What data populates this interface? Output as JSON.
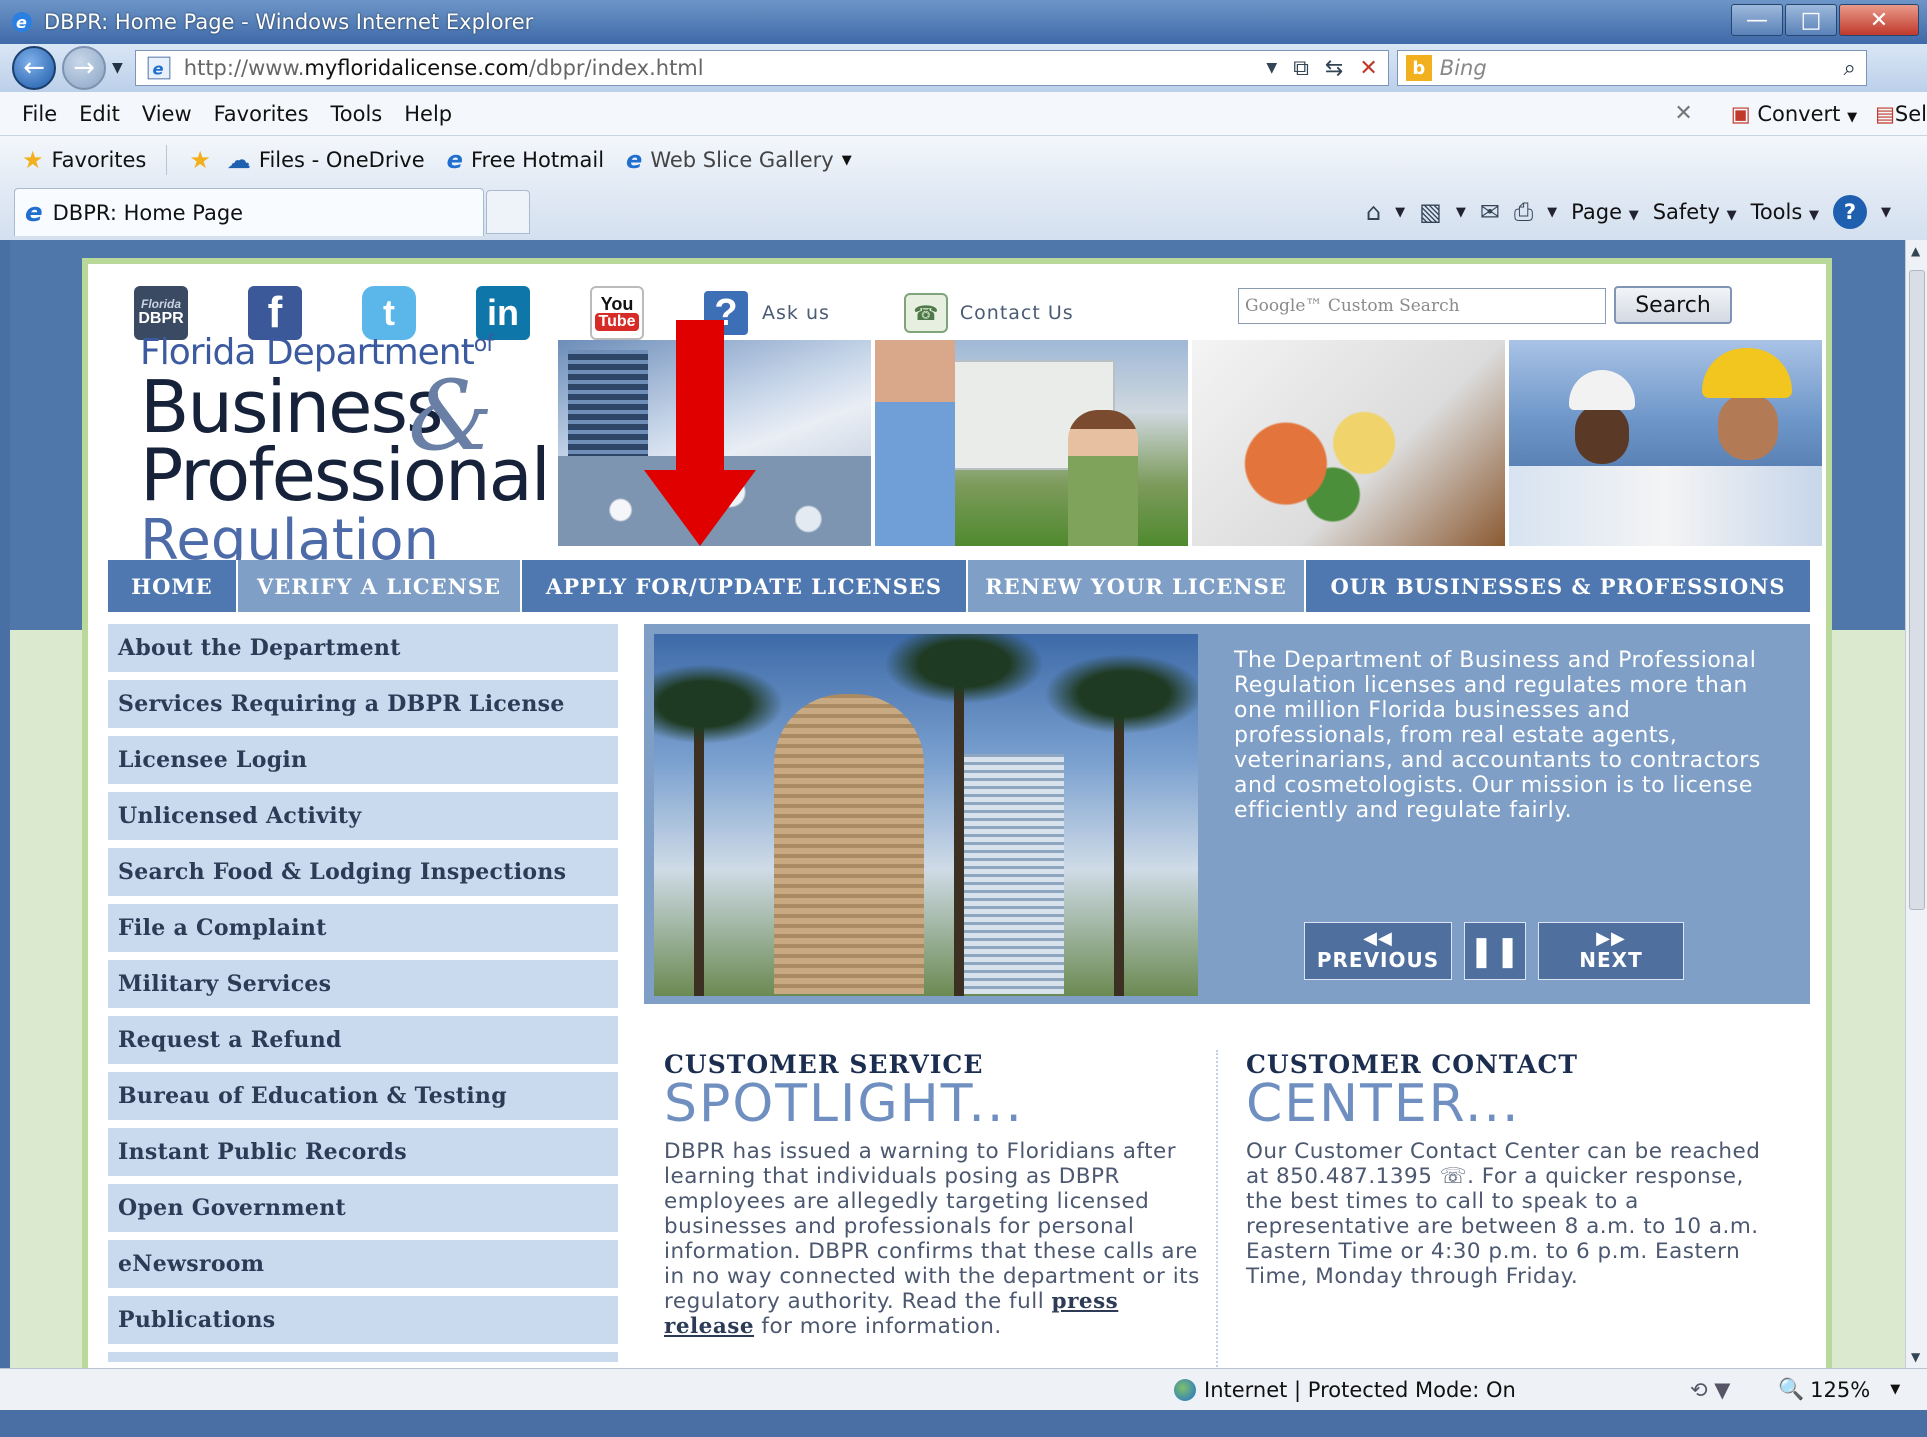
{
  "browser": {
    "window_title": "DBPR: Home Page - Windows Internet Explorer",
    "url_prefix": "http://www.",
    "url_domain": "myfloridalicense.com",
    "url_path": "/dbpr/index.html",
    "search_placeholder": "Bing",
    "menu": [
      "File",
      "Edit",
      "View",
      "Favorites",
      "Tools",
      "Help"
    ],
    "convert_label": "Convert",
    "select_label": "Sel",
    "favorites_label": "Favorites",
    "favorites_items": [
      "Files - OneDrive",
      "Free Hotmail",
      "Web Slice Gallery"
    ],
    "tab_title": "DBPR: Home Page",
    "commands": {
      "page": "Page",
      "safety": "Safety",
      "tools": "Tools"
    },
    "status_zone": "Internet | Protected Mode: On",
    "zoom": "125%"
  },
  "header": {
    "dbpr_badge_top": "Florida",
    "dbpr_badge_bottom": "DBPR",
    "youtube_top": "You",
    "youtube_bottom": "Tube",
    "ask_us": "Ask us",
    "contact_us": "Contact Us",
    "search_placeholder": "Google™ Custom Search",
    "search_button": "Search",
    "logo_line1": "Florida Department",
    "logo_of": "of",
    "logo_line2": "Business",
    "logo_line3": "Professional",
    "logo_line4": "Regulation"
  },
  "nav": [
    "HOME",
    "VERIFY A LICENSE",
    "APPLY FOR/UPDATE LICENSES",
    "RENEW YOUR LICENSE",
    "OUR BUSINESSES & PROFESSIONS"
  ],
  "left_menu": [
    "About the Department",
    "Services Requiring a DBPR License",
    "Licensee Login",
    "Unlicensed Activity",
    "Search Food & Lodging Inspections",
    "File a Complaint",
    "Military Services",
    "Request a Refund",
    "Bureau of Education & Testing",
    "Instant Public Records",
    "Open Government",
    "eNewsroom",
    "Publications"
  ],
  "feature": {
    "text": "The Department of Business and Professional Regulation licenses and regulates more than one million Florida businesses and professionals, from real estate agents, veterinarians, and accountants to contractors and cosmetologists. Our mission is to license efficiently and regulate fairly.",
    "prev": "PREVIOUS",
    "next": "NEXT"
  },
  "spotlight": {
    "heading1": "CUSTOMER SERVICE",
    "heading2": "SPOTLIGHT...",
    "body_before": "DBPR has issued a warning to Floridians after learning that individuals posing as DBPR employees are allegedly targeting licensed businesses and professionals for personal information. DBPR confirms that these calls are in no way connected with the department or its regulatory authority. Read the full ",
    "link": "press release",
    "body_after": " for more information."
  },
  "contact": {
    "heading1": "CUSTOMER CONTACT",
    "heading2": "CENTER...",
    "body": "Our Customer Contact Center can be reached at 850.487.1395 ☏. For a quicker response, the best times to call to speak to a representative are between 8 a.m. to 10 a.m. Eastern Time or 4:30 p.m. to 6 p.m. Eastern Time, Monday through Friday."
  },
  "colors": {
    "nav_active": "#4f78b0",
    "nav_inactive": "#7f9fc6",
    "menu_bg": "#c9d9ee",
    "arrow": "#e00000"
  }
}
